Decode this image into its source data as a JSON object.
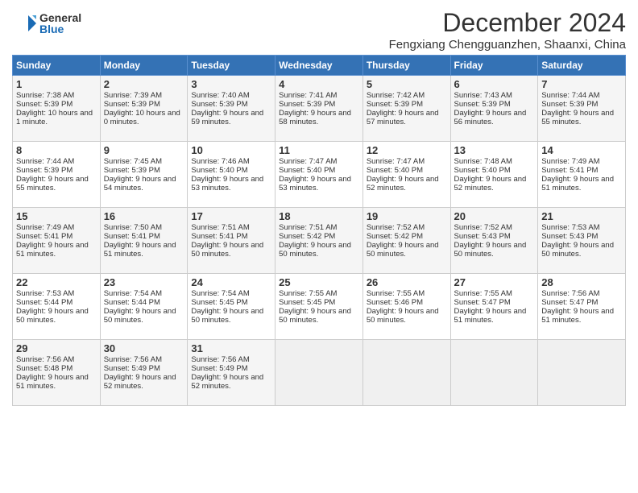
{
  "logo": {
    "general": "General",
    "blue": "Blue"
  },
  "title": "December 2024",
  "location": "Fengxiang Chengguanzhen, Shaanxi, China",
  "headers": [
    "Sunday",
    "Monday",
    "Tuesday",
    "Wednesday",
    "Thursday",
    "Friday",
    "Saturday"
  ],
  "weeks": [
    [
      {
        "day": "1",
        "sunrise": "Sunrise: 7:38 AM",
        "sunset": "Sunset: 5:39 PM",
        "daylight": "Daylight: 10 hours and 1 minute."
      },
      {
        "day": "2",
        "sunrise": "Sunrise: 7:39 AM",
        "sunset": "Sunset: 5:39 PM",
        "daylight": "Daylight: 10 hours and 0 minutes."
      },
      {
        "day": "3",
        "sunrise": "Sunrise: 7:40 AM",
        "sunset": "Sunset: 5:39 PM",
        "daylight": "Daylight: 9 hours and 59 minutes."
      },
      {
        "day": "4",
        "sunrise": "Sunrise: 7:41 AM",
        "sunset": "Sunset: 5:39 PM",
        "daylight": "Daylight: 9 hours and 58 minutes."
      },
      {
        "day": "5",
        "sunrise": "Sunrise: 7:42 AM",
        "sunset": "Sunset: 5:39 PM",
        "daylight": "Daylight: 9 hours and 57 minutes."
      },
      {
        "day": "6",
        "sunrise": "Sunrise: 7:43 AM",
        "sunset": "Sunset: 5:39 PM",
        "daylight": "Daylight: 9 hours and 56 minutes."
      },
      {
        "day": "7",
        "sunrise": "Sunrise: 7:44 AM",
        "sunset": "Sunset: 5:39 PM",
        "daylight": "Daylight: 9 hours and 55 minutes."
      }
    ],
    [
      {
        "day": "8",
        "sunrise": "Sunrise: 7:44 AM",
        "sunset": "Sunset: 5:39 PM",
        "daylight": "Daylight: 9 hours and 55 minutes."
      },
      {
        "day": "9",
        "sunrise": "Sunrise: 7:45 AM",
        "sunset": "Sunset: 5:39 PM",
        "daylight": "Daylight: 9 hours and 54 minutes."
      },
      {
        "day": "10",
        "sunrise": "Sunrise: 7:46 AM",
        "sunset": "Sunset: 5:40 PM",
        "daylight": "Daylight: 9 hours and 53 minutes."
      },
      {
        "day": "11",
        "sunrise": "Sunrise: 7:47 AM",
        "sunset": "Sunset: 5:40 PM",
        "daylight": "Daylight: 9 hours and 53 minutes."
      },
      {
        "day": "12",
        "sunrise": "Sunrise: 7:47 AM",
        "sunset": "Sunset: 5:40 PM",
        "daylight": "Daylight: 9 hours and 52 minutes."
      },
      {
        "day": "13",
        "sunrise": "Sunrise: 7:48 AM",
        "sunset": "Sunset: 5:40 PM",
        "daylight": "Daylight: 9 hours and 52 minutes."
      },
      {
        "day": "14",
        "sunrise": "Sunrise: 7:49 AM",
        "sunset": "Sunset: 5:41 PM",
        "daylight": "Daylight: 9 hours and 51 minutes."
      }
    ],
    [
      {
        "day": "15",
        "sunrise": "Sunrise: 7:49 AM",
        "sunset": "Sunset: 5:41 PM",
        "daylight": "Daylight: 9 hours and 51 minutes."
      },
      {
        "day": "16",
        "sunrise": "Sunrise: 7:50 AM",
        "sunset": "Sunset: 5:41 PM",
        "daylight": "Daylight: 9 hours and 51 minutes."
      },
      {
        "day": "17",
        "sunrise": "Sunrise: 7:51 AM",
        "sunset": "Sunset: 5:41 PM",
        "daylight": "Daylight: 9 hours and 50 minutes."
      },
      {
        "day": "18",
        "sunrise": "Sunrise: 7:51 AM",
        "sunset": "Sunset: 5:42 PM",
        "daylight": "Daylight: 9 hours and 50 minutes."
      },
      {
        "day": "19",
        "sunrise": "Sunrise: 7:52 AM",
        "sunset": "Sunset: 5:42 PM",
        "daylight": "Daylight: 9 hours and 50 minutes."
      },
      {
        "day": "20",
        "sunrise": "Sunrise: 7:52 AM",
        "sunset": "Sunset: 5:43 PM",
        "daylight": "Daylight: 9 hours and 50 minutes."
      },
      {
        "day": "21",
        "sunrise": "Sunrise: 7:53 AM",
        "sunset": "Sunset: 5:43 PM",
        "daylight": "Daylight: 9 hours and 50 minutes."
      }
    ],
    [
      {
        "day": "22",
        "sunrise": "Sunrise: 7:53 AM",
        "sunset": "Sunset: 5:44 PM",
        "daylight": "Daylight: 9 hours and 50 minutes."
      },
      {
        "day": "23",
        "sunrise": "Sunrise: 7:54 AM",
        "sunset": "Sunset: 5:44 PM",
        "daylight": "Daylight: 9 hours and 50 minutes."
      },
      {
        "day": "24",
        "sunrise": "Sunrise: 7:54 AM",
        "sunset": "Sunset: 5:45 PM",
        "daylight": "Daylight: 9 hours and 50 minutes."
      },
      {
        "day": "25",
        "sunrise": "Sunrise: 7:55 AM",
        "sunset": "Sunset: 5:45 PM",
        "daylight": "Daylight: 9 hours and 50 minutes."
      },
      {
        "day": "26",
        "sunrise": "Sunrise: 7:55 AM",
        "sunset": "Sunset: 5:46 PM",
        "daylight": "Daylight: 9 hours and 50 minutes."
      },
      {
        "day": "27",
        "sunrise": "Sunrise: 7:55 AM",
        "sunset": "Sunset: 5:47 PM",
        "daylight": "Daylight: 9 hours and 51 minutes."
      },
      {
        "day": "28",
        "sunrise": "Sunrise: 7:56 AM",
        "sunset": "Sunset: 5:47 PM",
        "daylight": "Daylight: 9 hours and 51 minutes."
      }
    ],
    [
      {
        "day": "29",
        "sunrise": "Sunrise: 7:56 AM",
        "sunset": "Sunset: 5:48 PM",
        "daylight": "Daylight: 9 hours and 51 minutes."
      },
      {
        "day": "30",
        "sunrise": "Sunrise: 7:56 AM",
        "sunset": "Sunset: 5:49 PM",
        "daylight": "Daylight: 9 hours and 52 minutes."
      },
      {
        "day": "31",
        "sunrise": "Sunrise: 7:56 AM",
        "sunset": "Sunset: 5:49 PM",
        "daylight": "Daylight: 9 hours and 52 minutes."
      },
      null,
      null,
      null,
      null
    ]
  ]
}
